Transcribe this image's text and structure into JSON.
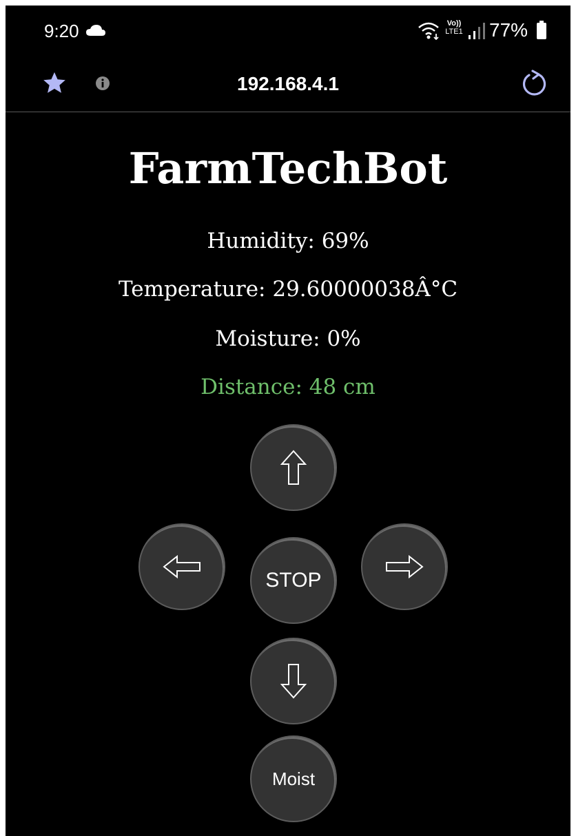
{
  "status_bar": {
    "time": "9:20",
    "battery": "77%",
    "network_label_top": "Vo))",
    "network_label_bottom": "LTE1"
  },
  "browser": {
    "url": "192.168.4.1"
  },
  "page": {
    "title": "FarmTechBot",
    "humidity": "Humidity: 69%",
    "temperature": "Temperature: 29.60000038Â°C",
    "moisture": "Moisture: 0%",
    "distance": "Distance: 48 cm",
    "distance_color": "#6fbf6b"
  },
  "controls": {
    "up_icon": "arrow-up-icon",
    "left_icon": "arrow-left-icon",
    "right_icon": "arrow-right-icon",
    "down_icon": "arrow-down-icon",
    "stop_label": "STOP",
    "moist_label": "Moist"
  },
  "colors": {
    "background": "#000000",
    "button": "#333333",
    "icon_accent": "#b3b8f5"
  }
}
